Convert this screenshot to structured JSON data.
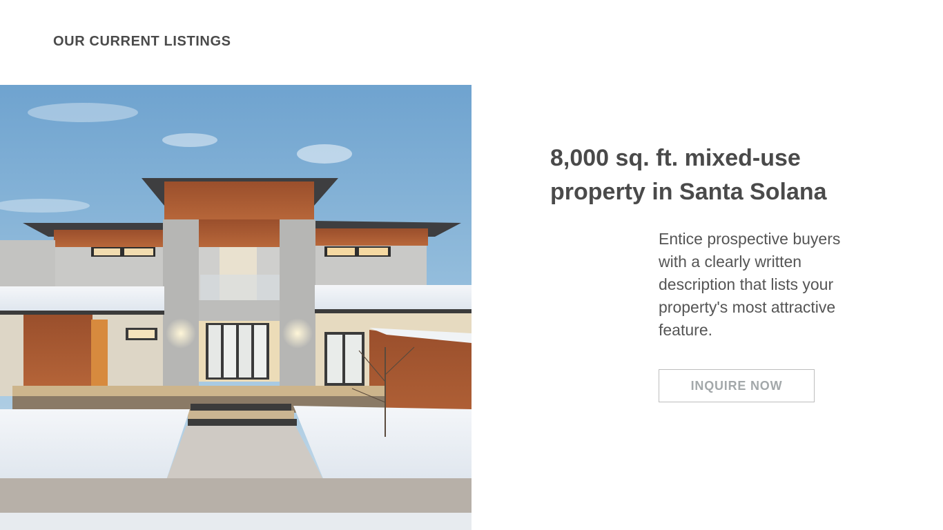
{
  "page": {
    "section_heading": "OUR CURRENT LISTINGS"
  },
  "listing": {
    "title": "8,000 sq. ft. mixed-use property in Santa Solana",
    "description": "Entice prospective buyers with a clearly written description that lists your property's most attractive feature.",
    "button_label": "INQUIRE NOW",
    "photo_subject": "modern two-story house with wood and stone facade in snow at dusk"
  },
  "colors": {
    "text": "#4a4a4a",
    "description_text": "#555555",
    "button_text": "#a3a8aa",
    "button_border": "#bdbdbd",
    "background": "#ffffff"
  }
}
